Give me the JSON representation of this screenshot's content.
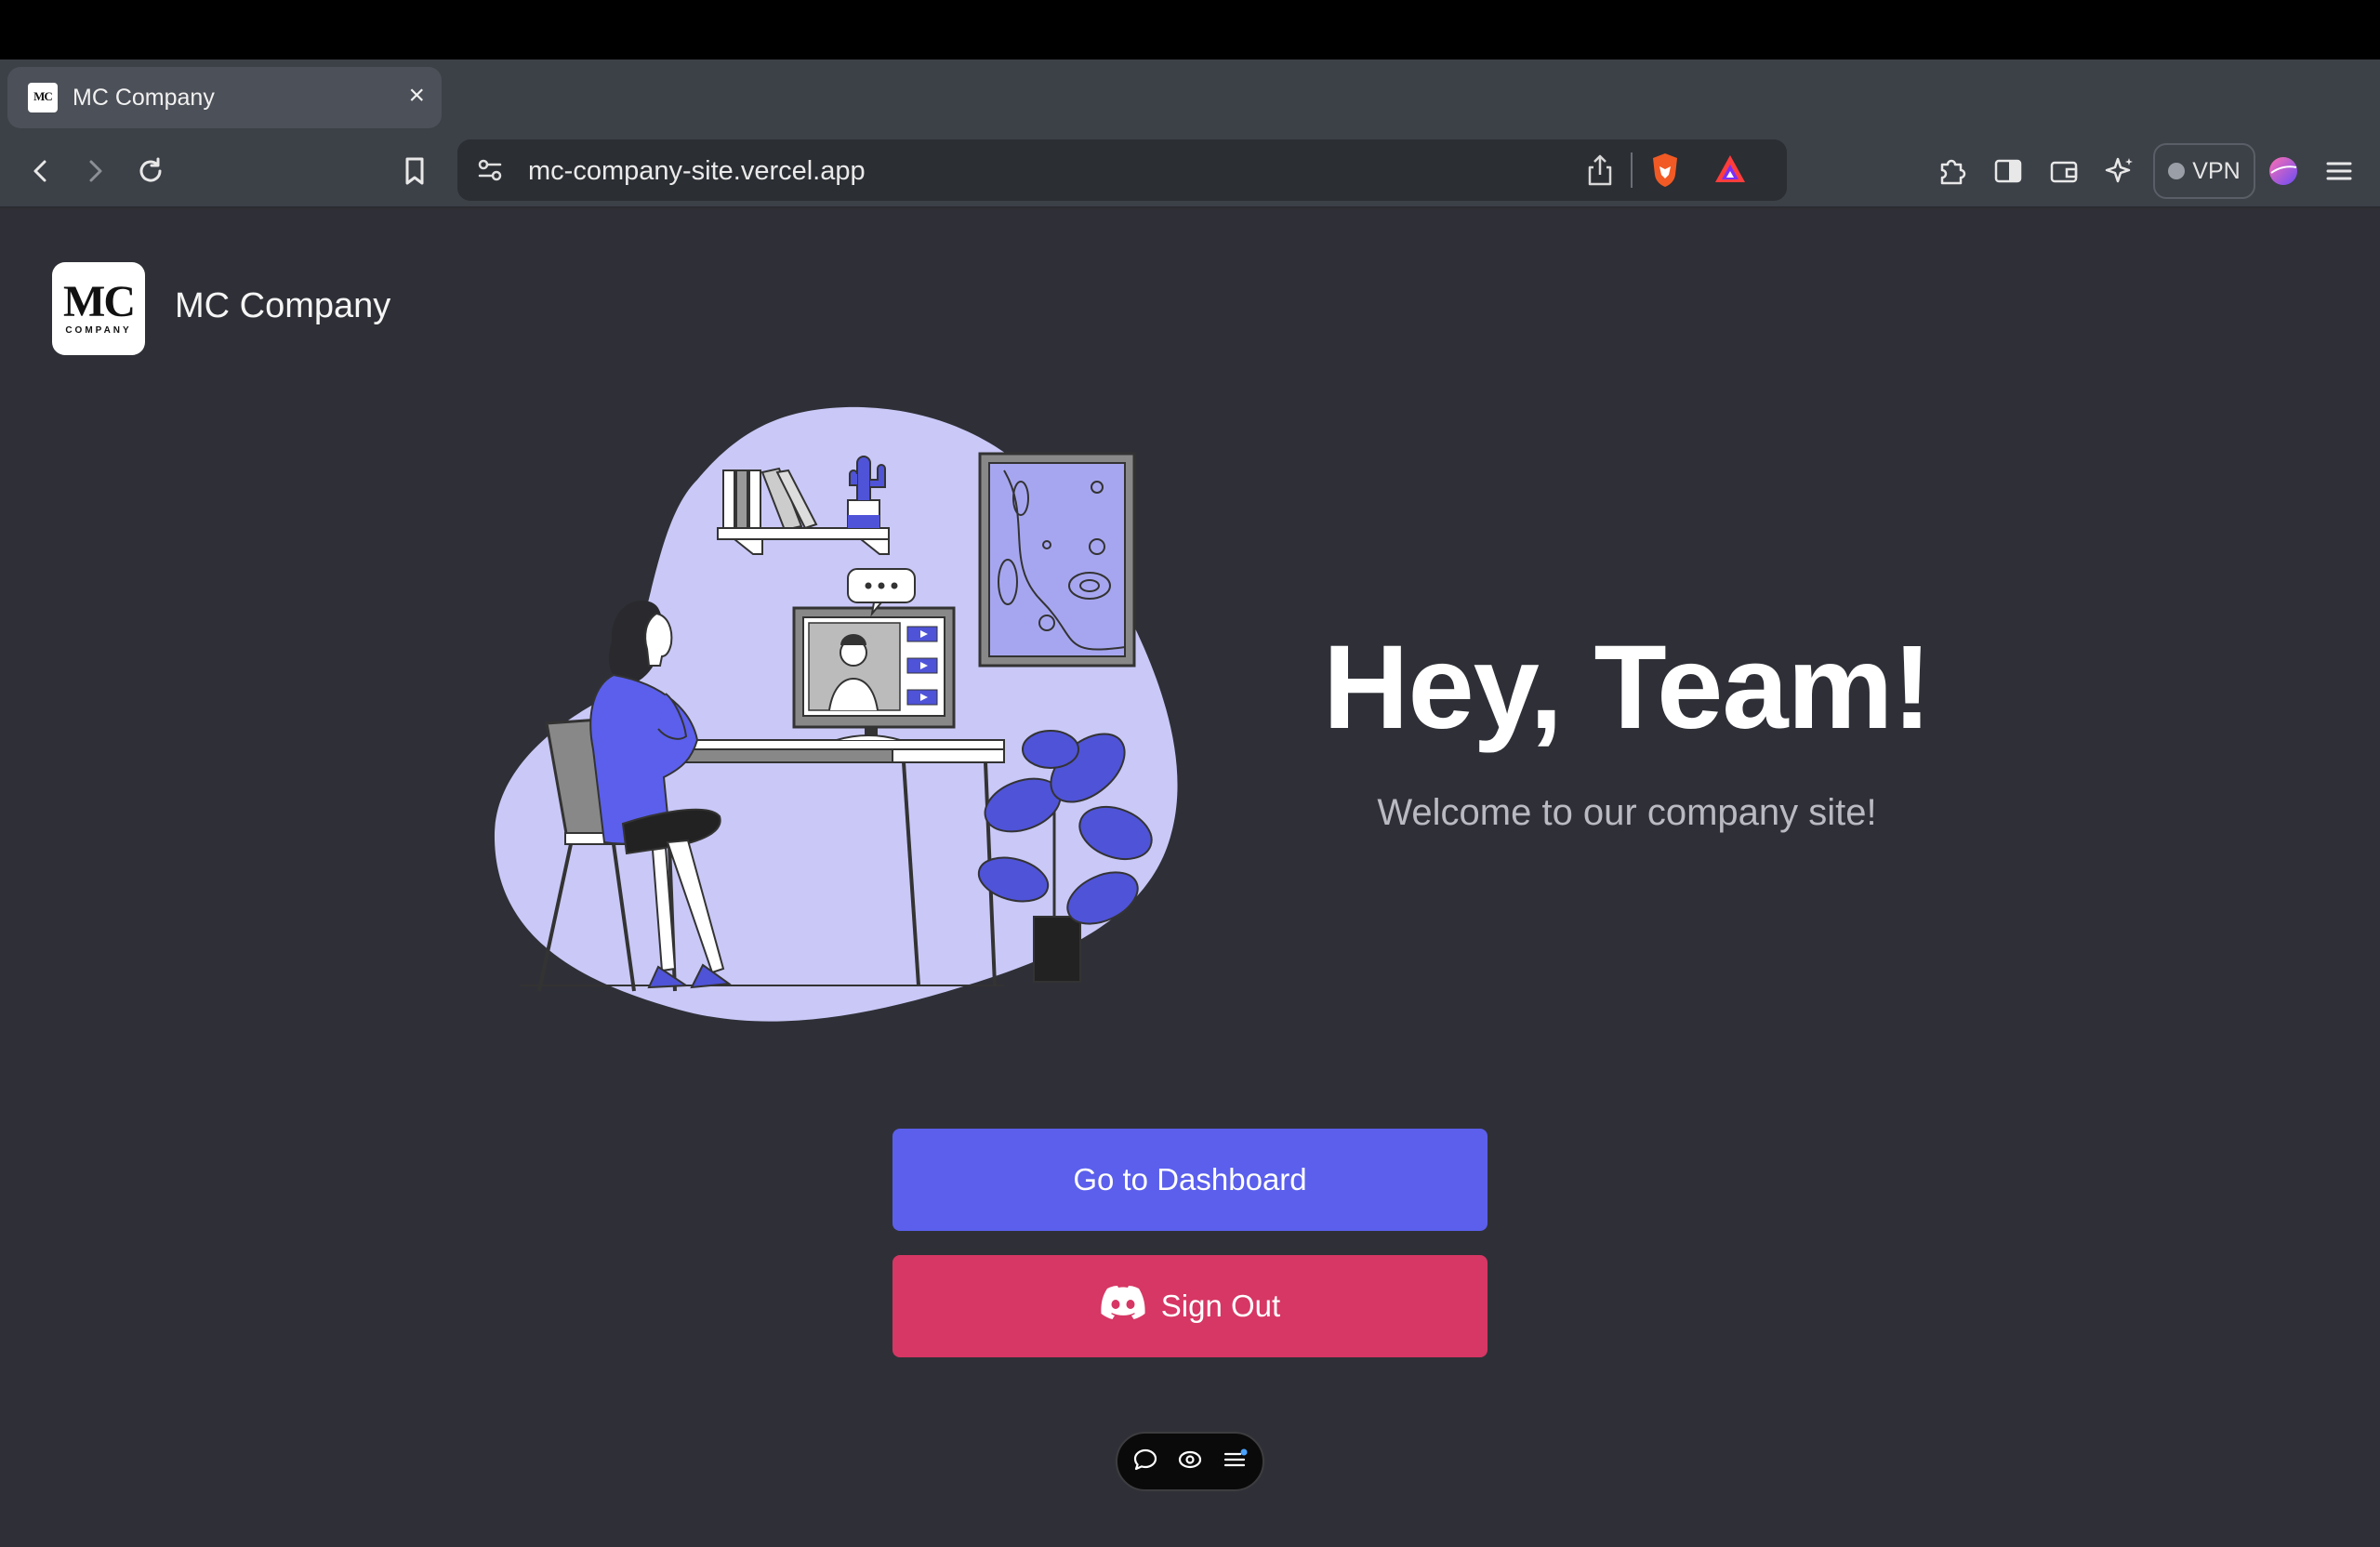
{
  "browser": {
    "tab": {
      "title": "MC Company",
      "favicon_text": "MC",
      "close_icon": "close-icon"
    },
    "new_tab_label": "+",
    "address": {
      "url": "mc-company-site.vercel.app"
    },
    "vpn_label": "VPN",
    "toolbar_icons": [
      "back-icon",
      "forward-icon",
      "reload-icon",
      "bookmark-icon",
      "site-settings-icon",
      "share-icon",
      "brave-shield-icon",
      "brave-rewards-icon",
      "extensions-icon",
      "sidebar-icon",
      "wallet-icon",
      "leo-ai-icon",
      "profile-icon",
      "menu-icon"
    ]
  },
  "site": {
    "logo": {
      "main": "MC",
      "sub": "COMPANY"
    },
    "brand_name": "MC Company",
    "hero": {
      "title": "Hey, Team!",
      "subtitle": "Welcome to our company site!"
    },
    "buttons": {
      "dashboard": "Go to Dashboard",
      "sign_out": "Sign Out"
    },
    "colors": {
      "background": "#2f3037",
      "dashboard_button": "#5b5fec",
      "sign_out_button": "#d63764",
      "illustration_bg": "#c9c8f7",
      "illustration_accent": "#4f53d8"
    }
  },
  "floating_toolbar": {
    "icons": [
      "comment-icon",
      "eye-icon",
      "list-icon"
    ]
  }
}
